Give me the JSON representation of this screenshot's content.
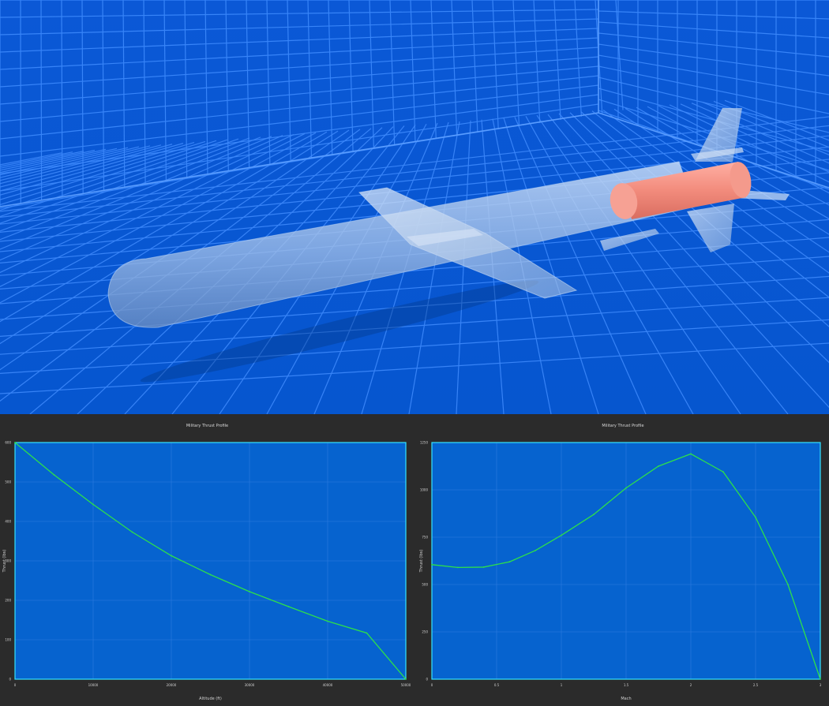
{
  "viewport": {
    "background": "#0a5ad8",
    "grid_color": "#3f8cff",
    "body_color": "#a9c7ee",
    "engine_color": "#f28b7c"
  },
  "plots": {
    "frame_color": "#35e3ff",
    "plot_bg": "#0663cf",
    "line_color": "#2de04a"
  },
  "chart_data": [
    {
      "type": "line",
      "title": "Military Thrust Profile",
      "xlabel": "Altitude (ft)",
      "ylabel": "Thrust (lbs)",
      "xlim": [
        0,
        50000
      ],
      "ylim": [
        0,
        600
      ],
      "x_ticks": [
        "0",
        "10000",
        "20000",
        "30000",
        "40000",
        "50000"
      ],
      "y_ticks": [
        "0",
        "100",
        "200",
        "300",
        "400",
        "500",
        "600"
      ],
      "x": [
        0,
        5000,
        10000,
        15000,
        20000,
        25000,
        30000,
        35000,
        40000,
        45000,
        50000
      ],
      "y": [
        600,
        518,
        443,
        373,
        313,
        265,
        222,
        184,
        147,
        117,
        0
      ]
    },
    {
      "type": "line",
      "title": "Military Thrust Profile",
      "xlabel": "Mach",
      "ylabel": "Thrust (lbs)",
      "xlim": [
        0,
        3
      ],
      "ylim": [
        0,
        1250
      ],
      "x_ticks": [
        "0",
        "0.5",
        "1",
        "1.5",
        "2",
        "2.5",
        "3"
      ],
      "y_ticks": [
        "0",
        "250",
        "500",
        "750",
        "1000",
        "1250"
      ],
      "x": [
        0,
        0.2,
        0.4,
        0.6,
        0.8,
        1.0,
        1.25,
        1.5,
        1.75,
        2.0,
        2.25,
        2.5,
        2.75,
        3.0
      ],
      "y": [
        605,
        590,
        592,
        620,
        680,
        760,
        870,
        1010,
        1125,
        1190,
        1095,
        855,
        500,
        0
      ]
    }
  ]
}
